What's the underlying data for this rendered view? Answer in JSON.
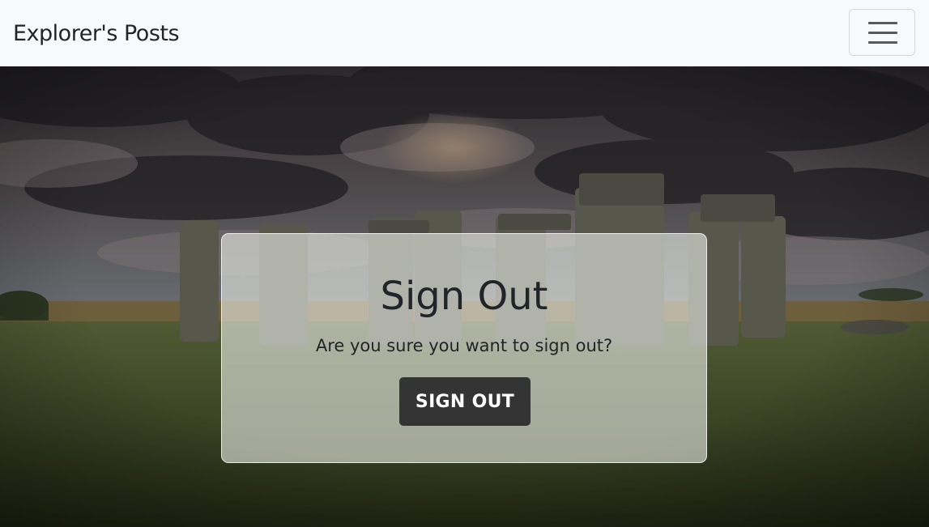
{
  "navbar": {
    "brand": "Explorer's Posts"
  },
  "hero": {
    "background": "stonehenge-photo"
  },
  "signout_card": {
    "title": "Sign Out",
    "message": "Are you sure you want to sign out?",
    "button_label": "SIGN OUT"
  },
  "colors": {
    "navbar_bg": "#f8f9fa",
    "text": "#212529",
    "button_bg": "#343434",
    "button_text": "#ffffff"
  },
  "icons": {
    "menu_toggle": "hamburger-icon"
  }
}
